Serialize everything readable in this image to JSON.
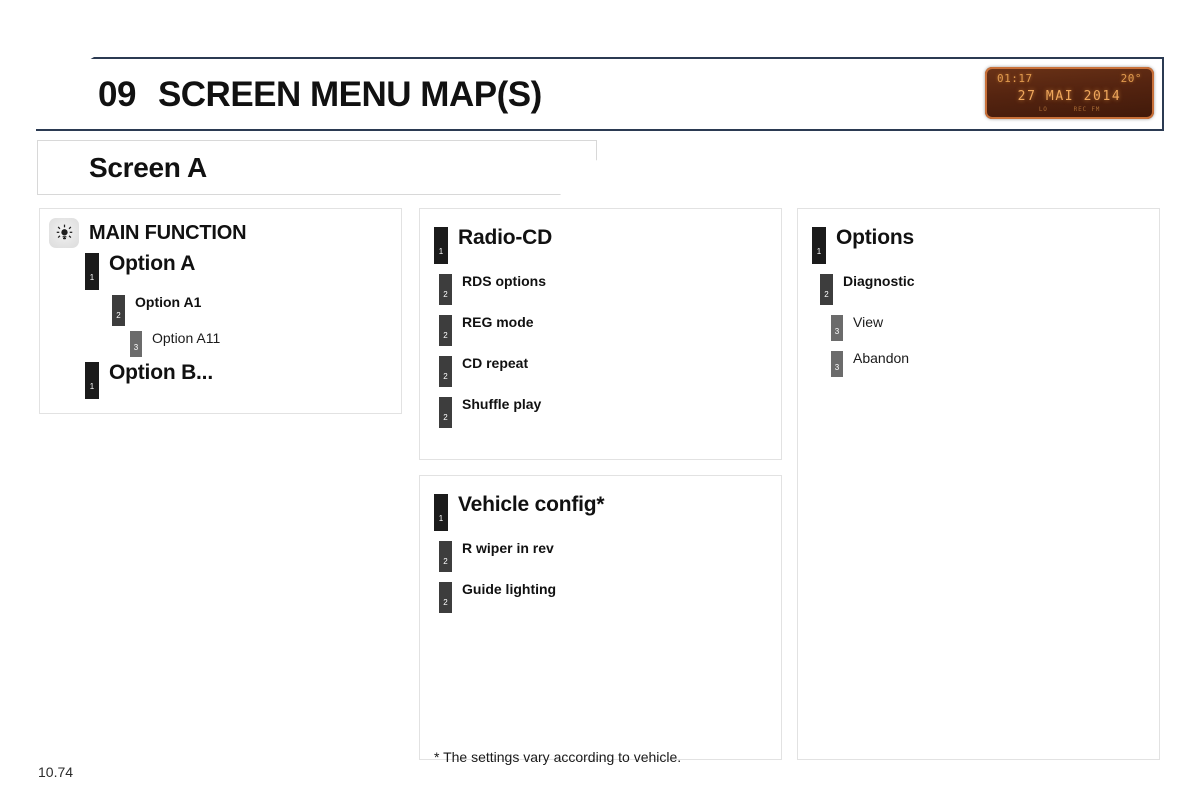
{
  "header": {
    "chapter_number": "09",
    "chapter_title": "SCREEN MENU MAP(S)",
    "border_color": "#2b3a52"
  },
  "lcd_display": {
    "icon": "car-lcd-display",
    "time": "01:17",
    "temperature": "20°",
    "date": "27 MAI 2014",
    "small_left": "LO",
    "small_right": "REC  FM",
    "background_color": "#552410",
    "text_color": "#e09a4e"
  },
  "screen_tab": {
    "label": "Screen A"
  },
  "panels": {
    "main_function": {
      "icon": "brightness-sun-icon",
      "title": "MAIN FUNCTION",
      "entries": [
        {
          "level": "1",
          "marker": "1",
          "label": "Option A"
        },
        {
          "level": "2",
          "marker": "2",
          "label": "Option A1"
        },
        {
          "level": "3",
          "marker": "3",
          "label": "Option A11"
        },
        {
          "level": "1",
          "marker": "1",
          "label": "Option B..."
        }
      ]
    },
    "radio_cd": {
      "title": "Radio-CD",
      "title_marker": "1",
      "entries": [
        {
          "level": "2",
          "marker": "2",
          "label": "RDS options"
        },
        {
          "level": "2",
          "marker": "2",
          "label": "REG mode"
        },
        {
          "level": "2",
          "marker": "2",
          "label": "CD repeat"
        },
        {
          "level": "2",
          "marker": "2",
          "label": "Shuffle play"
        }
      ]
    },
    "vehicle_config": {
      "title": "Vehicle config*",
      "title_marker": "1",
      "entries": [
        {
          "level": "2",
          "marker": "2",
          "label": "R wiper in rev"
        },
        {
          "level": "2",
          "marker": "2",
          "label": "Guide lighting"
        }
      ],
      "footnote": "* The settings vary according to vehicle."
    },
    "options": {
      "title": "Options",
      "title_marker": "1",
      "entries": [
        {
          "level": "2",
          "marker": "2",
          "label": "Diagnostic"
        },
        {
          "level": "3",
          "marker": "3",
          "label": "View"
        },
        {
          "level": "3",
          "marker": "3",
          "label": "Abandon"
        }
      ]
    }
  },
  "page_number": "10.74"
}
